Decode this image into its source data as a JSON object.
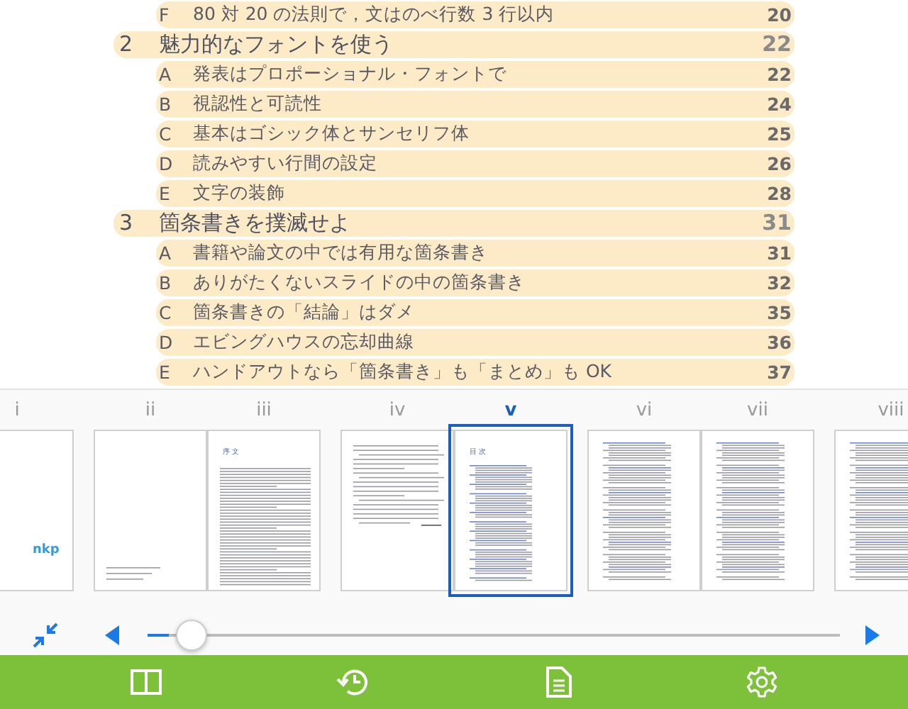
{
  "toc": [
    {
      "kind": "item",
      "mark": "F",
      "title": "80 対 20 の法則で，文はのべ行数 3 行以内",
      "page": "20"
    },
    {
      "kind": "section",
      "mark": "2",
      "title": "魅力的なフォントを使う",
      "page": "22"
    },
    {
      "kind": "item",
      "mark": "A",
      "title": "発表はプロポーショナル・フォントで",
      "page": "22"
    },
    {
      "kind": "item",
      "mark": "B",
      "title": "視認性と可読性",
      "page": "24"
    },
    {
      "kind": "item",
      "mark": "C",
      "title": "基本はゴシック体とサンセリフ体",
      "page": "25"
    },
    {
      "kind": "item",
      "mark": "D",
      "title": "読みやすい行間の設定",
      "page": "26"
    },
    {
      "kind": "item",
      "mark": "E",
      "title": "文字の装飾",
      "page": "28"
    },
    {
      "kind": "section",
      "mark": "3",
      "title": "箇条書きを撲滅せよ",
      "page": "31"
    },
    {
      "kind": "item",
      "mark": "A",
      "title": "書籍や論文の中では有用な箇条書き",
      "page": "31"
    },
    {
      "kind": "item",
      "mark": "B",
      "title": "ありがたくないスライドの中の箇条書き",
      "page": "32"
    },
    {
      "kind": "item",
      "mark": "C",
      "title": "箇条書きの「結論」はダメ",
      "page": "35"
    },
    {
      "kind": "item",
      "mark": "D",
      "title": "エビングハウスの忘却曲線",
      "page": "36"
    },
    {
      "kind": "item",
      "mark": "E",
      "title": "ハンドアウトなら「箇条書き」も「まとめ」も OK",
      "page": "37"
    }
  ],
  "thumbnails": [
    {
      "pages": [
        {
          "label": "i",
          "selected": false,
          "kind": "logo",
          "heading": "nkp"
        }
      ]
    },
    {
      "pages": [
        {
          "label": "ii",
          "selected": false,
          "kind": "imprint"
        },
        {
          "label": "iii",
          "selected": false,
          "kind": "preface",
          "heading": "序 文"
        }
      ]
    },
    {
      "pages": [
        {
          "label": "iv",
          "selected": false,
          "kind": "text"
        },
        {
          "label": "v",
          "selected": true,
          "kind": "contents",
          "heading": "目 次"
        }
      ]
    },
    {
      "pages": [
        {
          "label": "vi",
          "selected": false,
          "kind": "list"
        },
        {
          "label": "vii",
          "selected": false,
          "kind": "list"
        }
      ]
    },
    {
      "pages": [
        {
          "label": "viii",
          "selected": false,
          "kind": "list"
        }
      ]
    }
  ],
  "slider": {
    "level": 0.03
  }
}
